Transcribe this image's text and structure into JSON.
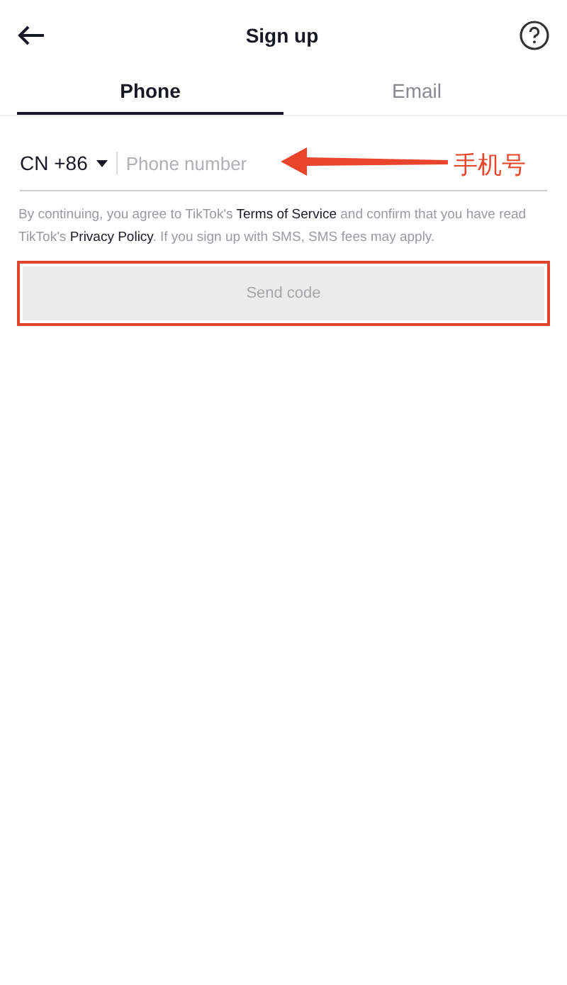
{
  "header": {
    "title": "Sign up"
  },
  "tabs": [
    {
      "label": "Phone",
      "selected": true
    },
    {
      "label": "Email",
      "selected": false
    }
  ],
  "phone": {
    "country_code": "CN +86",
    "placeholder": "Phone number"
  },
  "annotation": {
    "label": "手机号"
  },
  "legal": [
    {
      "kind": "text",
      "text": "By continuing, you agree to TikTok's "
    },
    {
      "kind": "link",
      "text": "Terms of Service"
    },
    {
      "kind": "text",
      "text": " and confirm that you have read TikTok's "
    },
    {
      "kind": "link",
      "text": "Privacy Policy"
    },
    {
      "kind": "text",
      "text": ". If you sign up with SMS, SMS fees may apply."
    }
  ],
  "send_button": {
    "label": "Send code",
    "disabled": true,
    "highlighted": true
  }
}
